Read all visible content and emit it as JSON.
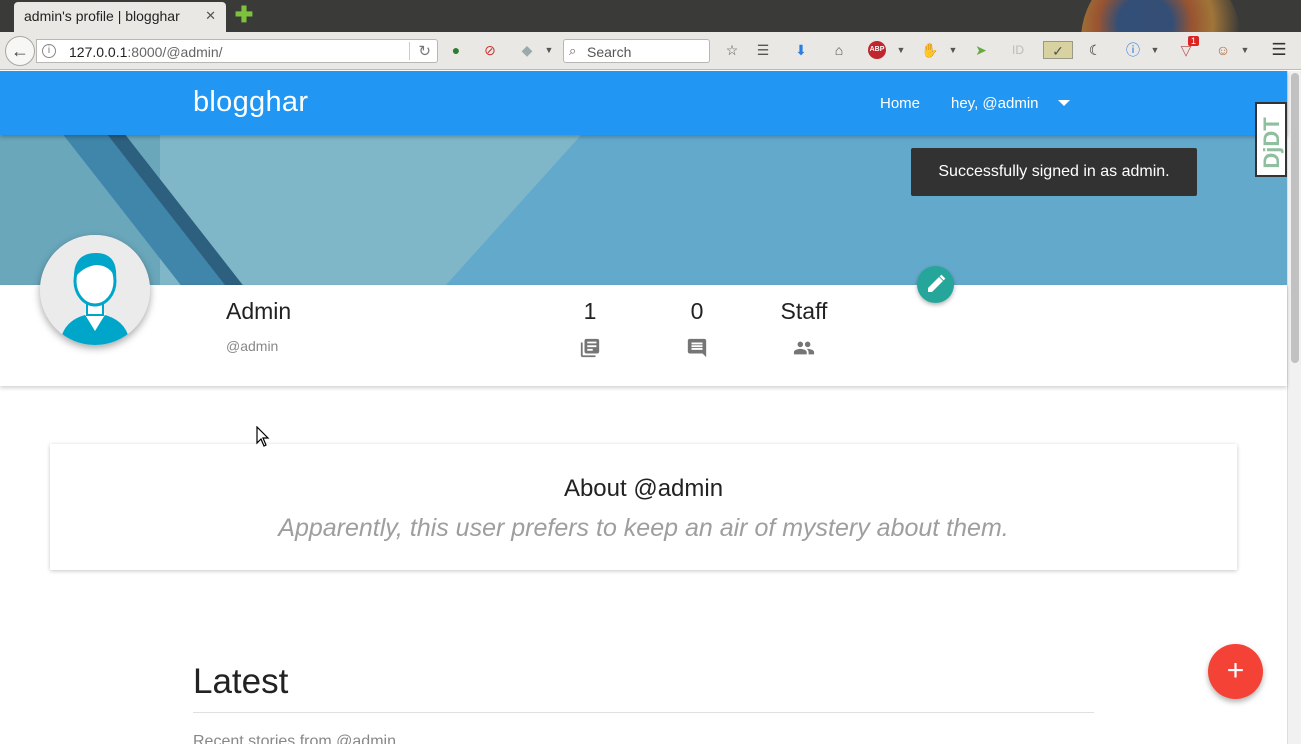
{
  "browser": {
    "tab_title": "admin's profile | blogghar",
    "tab_close": "✕",
    "new_tab": "✚",
    "url_host": "127.0.0.1",
    "url_rest": ":8000/@admin/",
    "search_placeholder": "Search",
    "notification_count": "1"
  },
  "site": {
    "brand": "blogghar",
    "nav_home": "Home",
    "nav_user": "hey, @admin"
  },
  "toast": {
    "message": "Successfully signed in as admin."
  },
  "debug_toolbar": {
    "label": "DjDT"
  },
  "profile": {
    "name": "Admin",
    "handle": "@admin",
    "stats": [
      {
        "value": "1",
        "icon": "library-books-icon"
      },
      {
        "value": "0",
        "icon": "comment-icon"
      },
      {
        "value": "Staff",
        "icon": "people-icon"
      }
    ]
  },
  "about": {
    "title": "About @admin",
    "text": "Apparently, this user prefers to keep an air of mystery about them."
  },
  "latest": {
    "title": "Latest",
    "subtitle": "Recent stories from @admin"
  },
  "fab": {
    "label": "+"
  },
  "colors": {
    "primary": "#2196f3",
    "accent": "#f44336",
    "teal": "#26a69a",
    "toast": "#323232"
  }
}
